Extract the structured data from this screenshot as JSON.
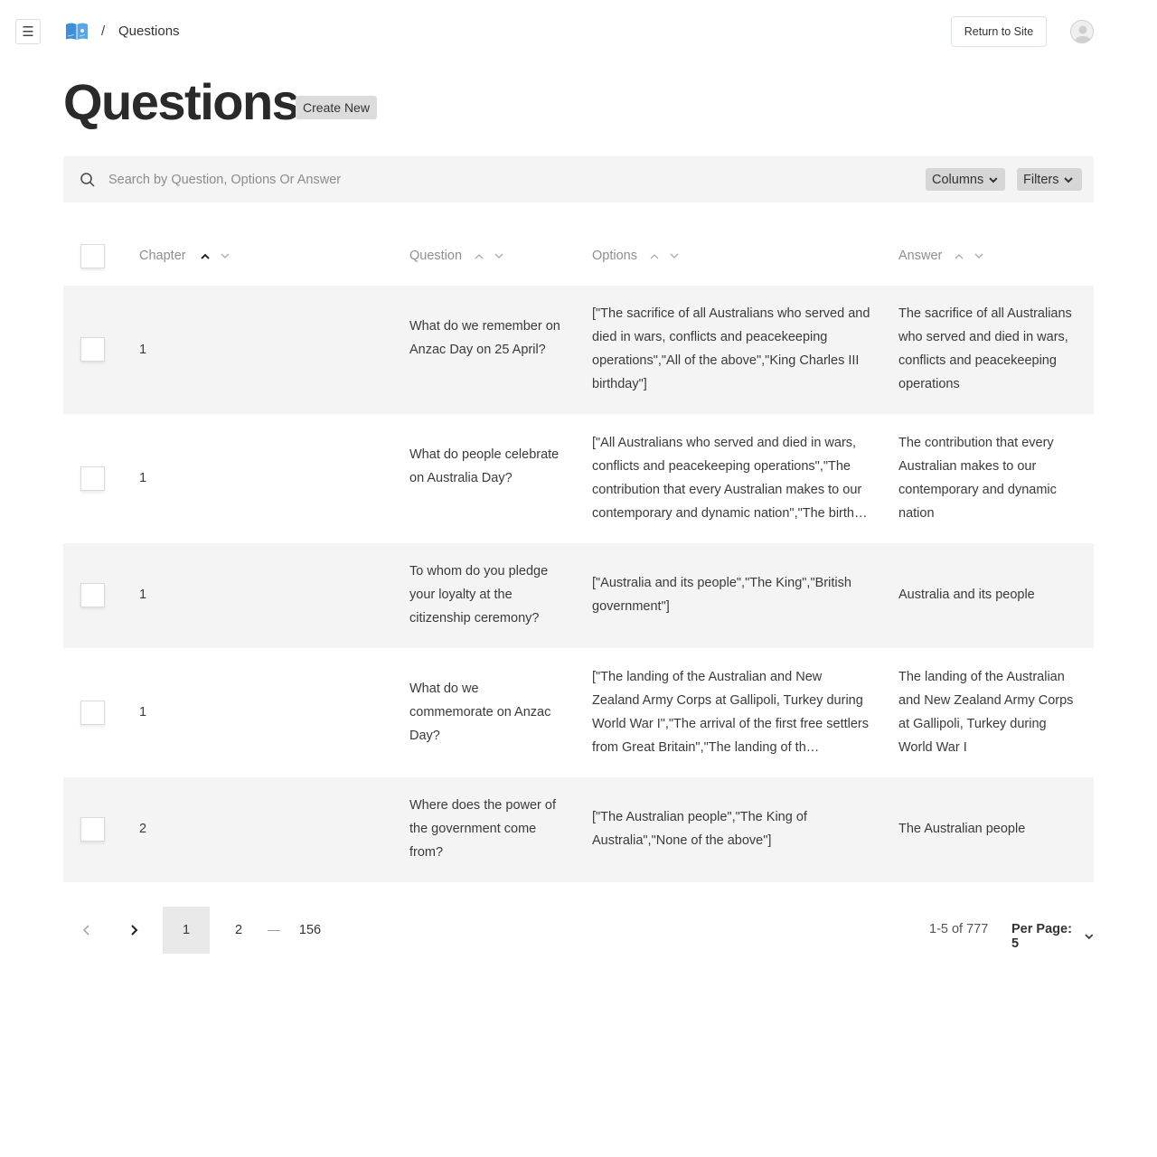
{
  "header": {
    "menu_icon": "hamburger-icon",
    "logo_icon": "open-book-icon",
    "breadcrumb_separator": "/",
    "breadcrumb_current": "Questions",
    "return_label": "Return to Site",
    "avatar_icon": "user-avatar-icon",
    "menu_glyph": "☰"
  },
  "page": {
    "title": "Questions",
    "create_label": "Create New"
  },
  "toolbar": {
    "search_placeholder": "Search by Question, Options Or Answer",
    "search_value": "",
    "columns_label": "Columns",
    "filters_label": "Filters"
  },
  "table": {
    "columns": [
      {
        "key": "chapter",
        "label": "Chapter",
        "sort": "asc"
      },
      {
        "key": "question",
        "label": "Question",
        "sort": "none"
      },
      {
        "key": "options",
        "label": "Options",
        "sort": "none"
      },
      {
        "key": "answer",
        "label": "Answer",
        "sort": "none"
      }
    ],
    "rows": [
      {
        "chapter": "1",
        "question": "What do we remember on Anzac Day on 25 April?",
        "options": "[\"The sacrifice of all Australians who served and died in wars, conflicts and peacekeeping operations\",\"All of the above\",\"King Charles III birthday\"]",
        "answer": "The sacrifice of all Australians who served and died in wars, conflicts and peacekeeping operations"
      },
      {
        "chapter": "1",
        "question": "What do people celebrate on Australia Day?",
        "options": "[\"All Australians who served and died in wars, conflicts and peacekeeping operations\",\"The contribution that every Australian makes to our contemporary and dynamic nation\",\"The birth…",
        "answer": "The contribution that every Australian makes to our contemporary and dynamic nation"
      },
      {
        "chapter": "1",
        "question": "To whom do you pledge your loyalty at the citizenship ceremony?",
        "options": "[\"Australia and its people\",\"The King\",\"British government\"]",
        "answer": "Australia and its people"
      },
      {
        "chapter": "1",
        "question": "What do we commemorate on Anzac Day?",
        "options": "[\"The landing of the Australian and New Zealand Army Corps at Gallipoli, Turkey during World War I\",\"The arrival of the first free settlers from Great Britain\",\"The landing of th…",
        "answer": "The landing of the Australian and New Zealand Army Corps at Gallipoli, Turkey during World War I"
      },
      {
        "chapter": "2",
        "question": "Where does the power of the government come from?",
        "options": "[\"The Australian people\",\"The King of Australia\",\"None of the above\"]",
        "answer": "The Australian people"
      }
    ]
  },
  "pagination": {
    "pages": [
      "1",
      "2"
    ],
    "ellipsis": "—",
    "last_page": "156",
    "current_page": "1",
    "range_text": "1-5 of 777",
    "per_page_label": "Per Page: 5"
  },
  "colors": {
    "row_shade": "#f4f4f4",
    "logo_blue": "#3f8fd8",
    "button_gray": "#d6d6d6"
  }
}
